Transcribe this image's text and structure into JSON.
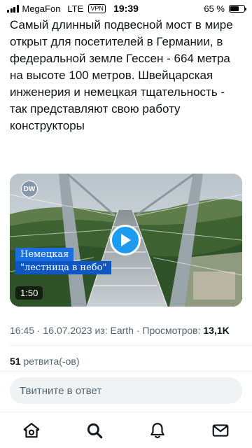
{
  "status_bar": {
    "carrier": "MegaFon",
    "network": "LTE",
    "vpn": "VPN",
    "time": "19:39",
    "battery_text": "65 %",
    "battery_level": 0.65
  },
  "tweet": {
    "text": "Самый длинный подвесной мост в мире открыт для посетителей в Германии, в федеральной земле Гессен - 664 метра на высоте 100 метров. Швейцарская инженерия и немецкая тщательность - так представляют свою работу конструкторы",
    "media": {
      "logo": "DW",
      "caption_line1": "Немецкая",
      "caption_line2": "\"лестница в небо\"",
      "duration": "1:50",
      "play_icon": "play-icon"
    },
    "meta": {
      "time": "16:45",
      "separator": " · ",
      "date": "16.07.2023",
      "source_prefix": " из: ",
      "source": "Earth",
      "views_label": "Просмотров: ",
      "views": "13,1K"
    },
    "retweets_count": "51",
    "retweets_label": " ретвита(-ов)"
  },
  "reply": {
    "placeholder": "Твитните в ответ"
  },
  "nav": {
    "items": [
      "home-icon",
      "search-icon",
      "notifications-icon",
      "messages-icon"
    ]
  },
  "colors": {
    "accent": "#1d9bf0",
    "text": "#0f1419",
    "muted": "#536471",
    "caption_blue": "#1a6ee0"
  }
}
